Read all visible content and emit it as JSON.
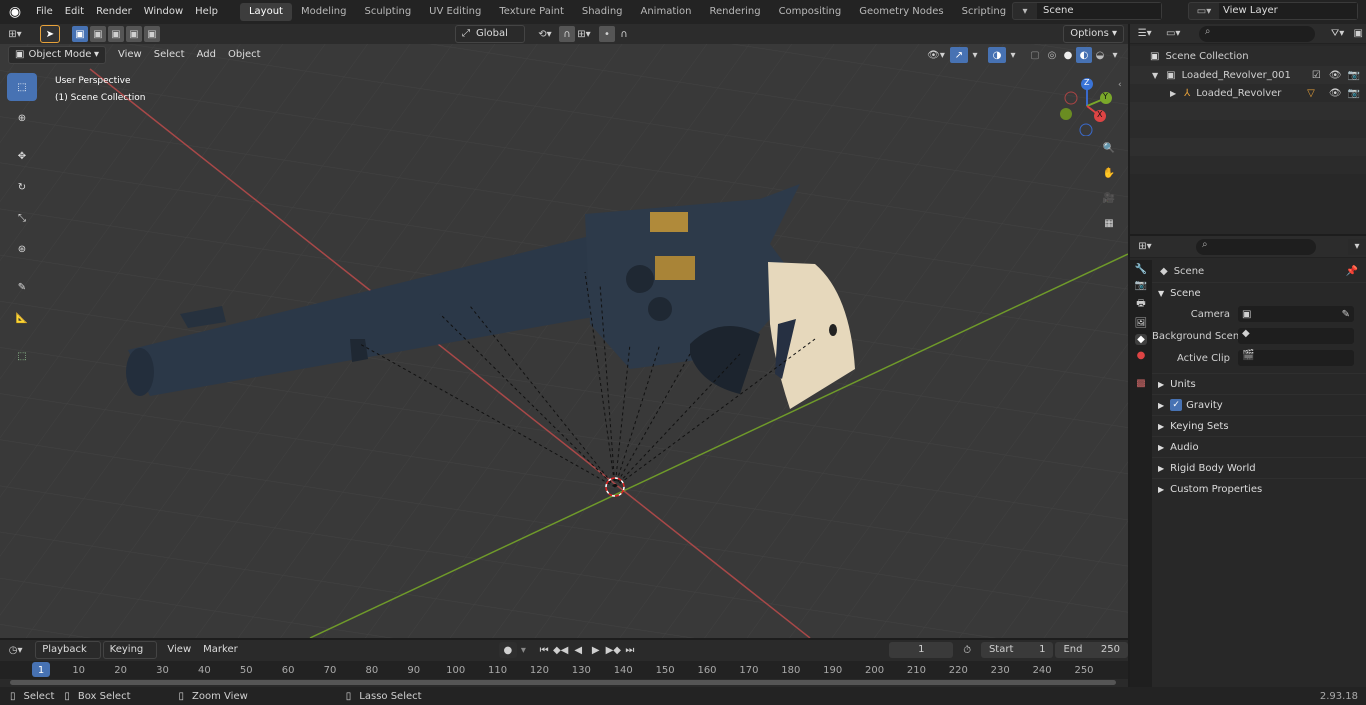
{
  "topbar": {
    "menus": [
      "File",
      "Edit",
      "Render",
      "Window",
      "Help"
    ],
    "workspaces": [
      "Layout",
      "Modeling",
      "Sculpting",
      "UV Editing",
      "Texture Paint",
      "Shading",
      "Animation",
      "Rendering",
      "Compositing",
      "Geometry Nodes",
      "Scripting"
    ],
    "active_workspace": "Layout",
    "scene": "Scene",
    "view_layer": "View Layer"
  },
  "viewport": {
    "mode": "Object Mode",
    "menus": [
      "View",
      "Select",
      "Add",
      "Object"
    ],
    "orientation": "Global",
    "options": "Options",
    "overlay_line1": "User Perspective",
    "overlay_line2": "(1) Scene Collection",
    "gizmo": {
      "x": "X",
      "y": "Y",
      "z": "Z"
    }
  },
  "outliner": {
    "root": "Scene Collection",
    "items": [
      {
        "label": "Loaded_Revolver_001"
      },
      {
        "label": "Loaded_Revolver"
      }
    ]
  },
  "properties": {
    "header": "Scene",
    "section": "Scene",
    "rows": [
      {
        "label": "Camera",
        "value": ""
      },
      {
        "label": "Background Scene",
        "value": ""
      },
      {
        "label": "Active Clip",
        "value": ""
      }
    ],
    "panels": [
      "Units",
      "Gravity",
      "Keying Sets",
      "Audio",
      "Rigid Body World",
      "Custom Properties"
    ]
  },
  "timeline": {
    "menus": [
      "Playback",
      "Keying",
      "View",
      "Marker"
    ],
    "current_frame": "1",
    "start_label": "Start",
    "start": "1",
    "end_label": "End",
    "end": "250",
    "ticks": [
      "1",
      "10",
      "20",
      "30",
      "40",
      "50",
      "60",
      "70",
      "80",
      "90",
      "100",
      "110",
      "120",
      "130",
      "140",
      "150",
      "160",
      "170",
      "180",
      "190",
      "200",
      "210",
      "220",
      "230",
      "240",
      "250"
    ]
  },
  "status": {
    "select": "Select",
    "box_select": "Box Select",
    "zoom": "Zoom View",
    "lasso": "Lasso Select",
    "version": "2.93.18"
  }
}
